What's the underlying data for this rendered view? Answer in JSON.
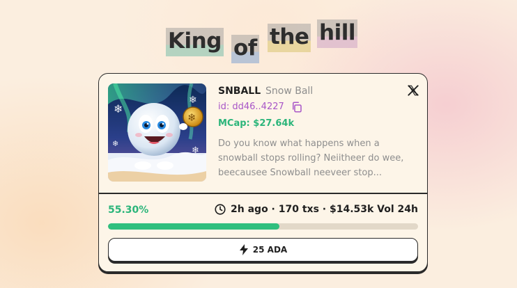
{
  "title": {
    "words": [
      "King",
      "of",
      "the",
      "hill"
    ]
  },
  "coin": {
    "ticker": "SNBALL",
    "name": "Snow Ball",
    "id": "id: dd46..4227",
    "mcap": "MCap: $27.64k",
    "description": "Do you know what happens when a snowball stops rolling? Neiitheer do wee, beecausee Snowball neeveer stop...",
    "progress_label": "55.30%",
    "progress_value": 55.3,
    "stats": "2h ago · 170 txs · $14.53k Vol 24h",
    "buy_label": "25 ADA"
  },
  "icons": {
    "social": "x-twitter-icon",
    "copy": "copy-icon",
    "time": "clock-icon",
    "buy": "lightning-bolt-icon"
  },
  "colors": {
    "accent_green": "#2bb57a",
    "id_purple": "#a855c7",
    "card_bg": "#fdf5e8",
    "border": "#2a2a2a"
  }
}
